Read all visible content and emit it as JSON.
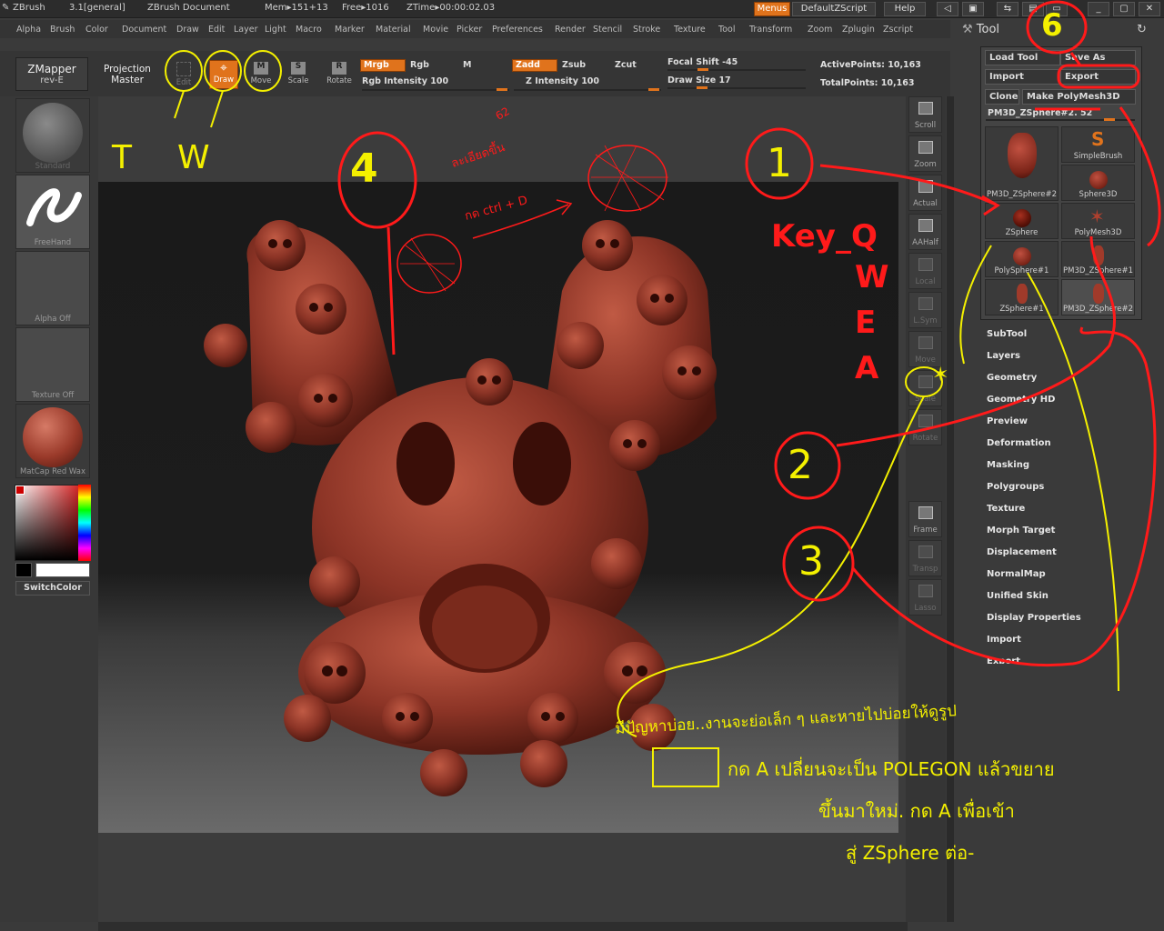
{
  "titlebar": {
    "app": "ZBrush",
    "version": "3.1[general]",
    "document": "ZBrush Document",
    "mem": "Mem▸151+13",
    "free": "Free▸1016",
    "ztime": "ZTime▸00:00:02.03",
    "menus_label": "Menus",
    "zscript_label": "DefaultZScript",
    "help_label": "Help"
  },
  "menubar": [
    "Alpha",
    "Brush",
    "Color",
    "Document",
    "Draw",
    "Edit",
    "Layer",
    "Light",
    "Macro",
    "Marker",
    "Material",
    "Movie",
    "Picker",
    "Preferences",
    "Render",
    "Stencil",
    "Stroke",
    "Texture",
    "Tool",
    "Transform",
    "Zoom",
    "Zplugin",
    "Zscript"
  ],
  "shelf": {
    "zmapper": "ZMapper",
    "zmapper_sub": "rev-E",
    "projection": "Projection",
    "projection_sub": "Master",
    "edit": "Edit",
    "draw": "Draw",
    "move": "Move",
    "scale": "Scale",
    "rotate": "Rotate",
    "mrgb": "Mrgb",
    "rgb": "Rgb",
    "m": "M",
    "rgb_intensity": "Rgb Intensity 100",
    "zadd": "Zadd",
    "zsub": "Zsub",
    "zcut": "Zcut",
    "z_intensity": "Z Intensity 100",
    "focal_shift": "Focal Shift -45",
    "draw_size": "Draw Size 17",
    "active_points": "ActivePoints: 10,163",
    "total_points": "TotalPoints: 10,163"
  },
  "left_panel": {
    "standard": "Standard",
    "freehand": "FreeHand",
    "alpha": "Alpha Off",
    "texture": "Texture Off",
    "matcap": "MatCap Red Wax",
    "switchcolor": "SwitchColor"
  },
  "right_tools": [
    {
      "label": "Scroll",
      "dim": false
    },
    {
      "label": "Zoom",
      "dim": false
    },
    {
      "label": "Actual",
      "dim": false
    },
    {
      "label": "AAHalf",
      "dim": false
    },
    {
      "label": "Local",
      "dim": true
    },
    {
      "label": "L.Sym",
      "dim": true
    },
    {
      "label": "Move",
      "dim": true
    },
    {
      "label": "Scale",
      "dim": true
    },
    {
      "label": "Rotate",
      "dim": true
    },
    {
      "label": "Frame",
      "dim": false
    },
    {
      "label": "Transp",
      "dim": true
    },
    {
      "label": "Lasso",
      "dim": true
    }
  ],
  "tool_panel": {
    "title": "Tool",
    "load_tool": "Load Tool",
    "save_as": "Save As",
    "import": "Import",
    "export": "Export",
    "clone": "Clone",
    "make_polymesh": "Make PolyMesh3D",
    "current_tool": "PM3D_ZSphere#2. 52",
    "thumbs": [
      {
        "name": "PM3D_ZSphere#2"
      },
      {
        "name": "SimpleBrush"
      },
      {
        "name": "Sphere3D"
      },
      {
        "name": "ZSphere"
      },
      {
        "name": "PolyMesh3D"
      },
      {
        "name": "PolySphere#1"
      },
      {
        "name": "PM3D_ZSphere#1"
      },
      {
        "name": "ZSphere#1"
      },
      {
        "name": "PM3D_ZSphere#2"
      }
    ],
    "subpalettes": [
      "SubTool",
      "Layers",
      "Geometry",
      "Geometry HD",
      "Preview",
      "Deformation",
      "Masking",
      "Polygroups",
      "Texture",
      "Morph Target",
      "Displacement",
      "NormalMap",
      "Unified Skin",
      "Display Properties",
      "Import",
      "Export"
    ]
  },
  "annotations": {
    "n1": "1",
    "n2": "2",
    "n3": "3",
    "n4": "4",
    "n6": "6",
    "key": "Key_Q",
    "w": "W",
    "e": "E",
    "a": "A",
    "t": "T",
    "tw_w": "W",
    "red_note1": "ละเอียดขึ้น",
    "red_note2": "กด ctrl + D",
    "num62": "62",
    "yellow_line1": "มีปัญหาบ่อย..งานจะย่อเล็ก ๆ และหายไปบ่อยให้ดูรูป",
    "yellow_line2": "กด A เปลี่ยนจะเป็น POLEGON แล้วขยาย",
    "yellow_line3": "ขึ้นมาใหม่. กด A เพื่อเข้า",
    "yellow_line4": "สู่ ZSphere ต่อ-"
  },
  "colors": {
    "accent_orange": "#e0731c",
    "annotation_red": "#ff1a1a",
    "annotation_yellow": "#f4f000",
    "model": "#8c3426"
  }
}
